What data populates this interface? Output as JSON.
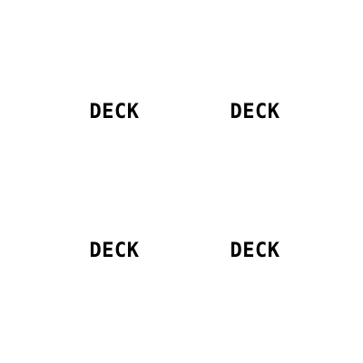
{
  "decks": [
    {
      "label": "DECK"
    },
    {
      "label": "DECK"
    },
    {
      "label": "DECK"
    },
    {
      "label": "DECK"
    }
  ]
}
